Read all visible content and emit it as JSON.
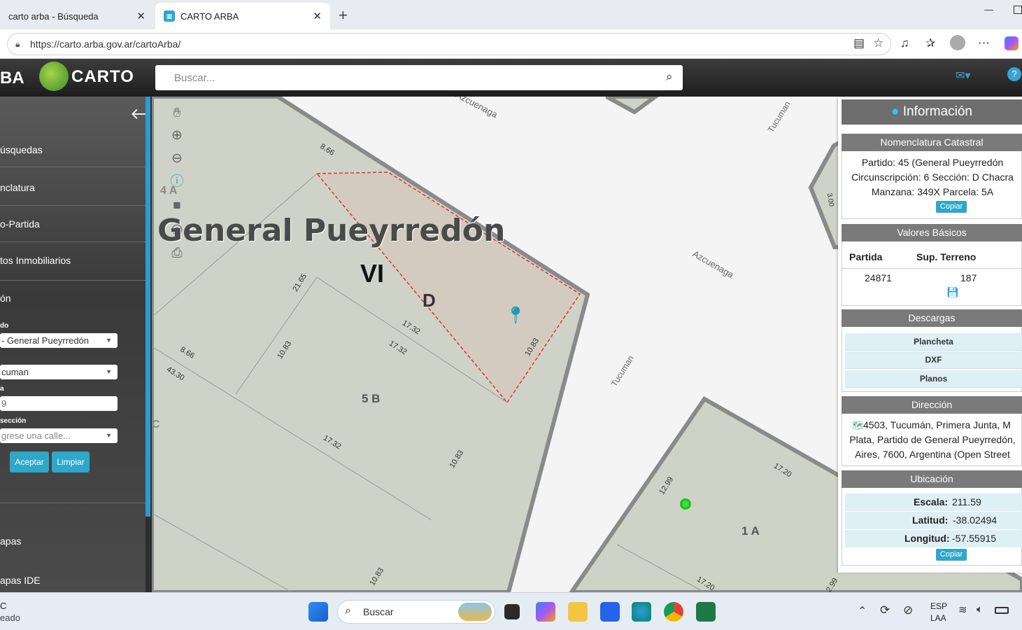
{
  "browser": {
    "tabs": [
      {
        "title": "carto arba - Búsqueda",
        "close": "✕"
      },
      {
        "title": "CARTO ARBA",
        "close": "✕"
      }
    ],
    "new_tab": "+",
    "url": "https://carto.arba.gov.ar/cartoArba/"
  },
  "app": {
    "brand_left": "BA",
    "logo_text": "CARTO",
    "search_placeholder": "Buscar..."
  },
  "sidebar": {
    "items": [
      "úsquedas",
      "nclatura",
      "o-Partida",
      "tos Inmobiliarios",
      "ón"
    ],
    "fields": [
      {
        "label": "do",
        "value": "- General Pueyrredón"
      },
      {
        "label": "",
        "value": "cuman"
      },
      {
        "label": "a",
        "value": "9"
      },
      {
        "label": "sección",
        "value": "grese una calle..."
      }
    ],
    "accept": "Aceptar",
    "clear": "Limpiar",
    "bottom_items": [
      "apas",
      "apas IDE"
    ]
  },
  "map": {
    "district": "General Pueyrredón",
    "circ": "VI",
    "section": "D",
    "parcels": [
      "5 B",
      "1 A",
      "4 A",
      "C"
    ],
    "streets": [
      "Azcuenaga",
      "Tucuman",
      "Tucuman",
      "Azcuenaga"
    ],
    "dimensions": [
      "8.66",
      "21.65",
      "17.32",
      "17.32",
      "10.83",
      "10.83",
      "8.66",
      "43.30",
      "17.32",
      "10.83",
      "10.83",
      "3.00",
      "12.99",
      "17.20",
      "17.20",
      "2.99"
    ]
  },
  "info": {
    "title": "Información",
    "nomenclatura": {
      "head": "Nomenclatura Catastral",
      "line1": "Partido: 45 (General Pueyrredón",
      "line2": "Circunscripción: 6 Sección: D Chacra",
      "line3": "Manzana: 349X Parcela: 5A",
      "copy": "Copiar"
    },
    "valores": {
      "head": "Valores Básicos",
      "col1": "Partida",
      "col2": "Sup. Terreno",
      "partida": "24871",
      "sup": "187"
    },
    "descargas": {
      "head": "Descargas",
      "items": [
        "Plancheta",
        "DXF",
        "Planos"
      ]
    },
    "direccion": {
      "head": "Dirección",
      "line1": "4503, Tucumán, Primera Junta, M",
      "line2": "Plata, Partido de General Pueyrredón,",
      "line3": "Aires, 7600, Argentina (Open Street"
    },
    "ubicacion": {
      "head": "Ubicación",
      "escala_label": "Escala:",
      "escala": "211.59",
      "lat_label": "Latitud:",
      "lat": "-38.02494",
      "lon_label": "Longitud:",
      "lon": "-57.55915",
      "copy": "Copiar"
    }
  },
  "taskbar": {
    "weather_line1": "C",
    "weather_line2": "eado",
    "search": "Buscar",
    "lang1": "ESP",
    "lang2": "LAA"
  }
}
